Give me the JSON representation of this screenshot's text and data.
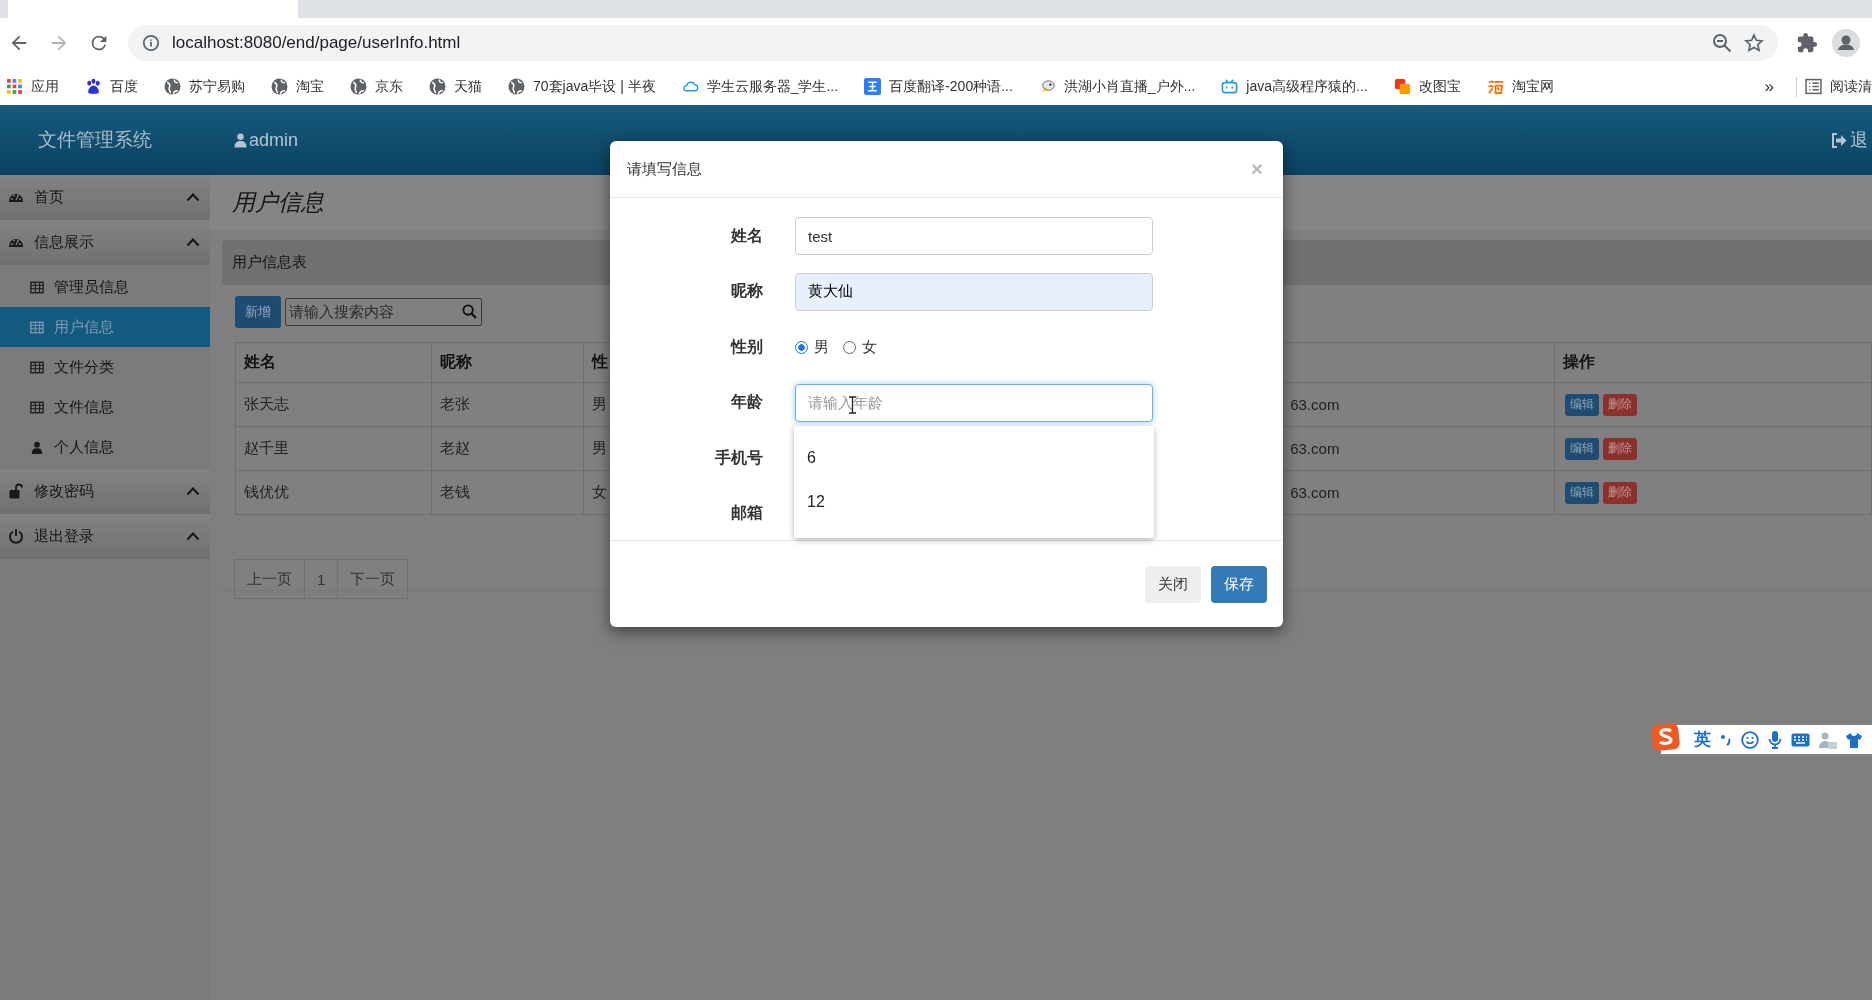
{
  "browser": {
    "url": "localhost:8080/end/page/userInfo.html",
    "bookmarks": [
      {
        "label": "应用",
        "kind": "apps"
      },
      {
        "label": "百度",
        "kind": "paw"
      },
      {
        "label": "苏宁易购",
        "kind": "globe"
      },
      {
        "label": "淘宝",
        "kind": "globe"
      },
      {
        "label": "京东",
        "kind": "globe"
      },
      {
        "label": "天猫",
        "kind": "globe"
      },
      {
        "label": "70套java毕设 | 半夜",
        "kind": "globe"
      },
      {
        "label": "学生云服务器_学生...",
        "kind": "cloud"
      },
      {
        "label": "百度翻译-200种语...",
        "kind": "translate"
      },
      {
        "label": "洪湖小肖直播_户外...",
        "kind": "bird"
      },
      {
        "label": "java高级程序猿的...",
        "kind": "tv"
      },
      {
        "label": "改图宝",
        "kind": "squares"
      },
      {
        "label": "淘宝网",
        "kind": "tao"
      }
    ],
    "overflow": "»",
    "reading_list": "阅读清"
  },
  "app": {
    "title": "文件管理系统",
    "user": "admin",
    "logout": "退"
  },
  "sidebar": {
    "groups": [
      {
        "label": "首页",
        "kind": "dashboard"
      },
      {
        "label": "信息展示",
        "kind": "dashboard",
        "items": [
          {
            "label": "管理员信息",
            "kind": "table",
            "selected": false
          },
          {
            "label": "用户信息",
            "kind": "table",
            "selected": true
          },
          {
            "label": "文件分类",
            "kind": "table",
            "selected": false
          },
          {
            "label": "文件信息",
            "kind": "table",
            "selected": false
          },
          {
            "label": "个人信息",
            "kind": "user",
            "selected": false
          }
        ]
      },
      {
        "label": "修改密码",
        "kind": "lock"
      },
      {
        "label": "退出登录",
        "kind": "power"
      }
    ]
  },
  "page": {
    "title": "用户信息",
    "panel_title": "用户信息表",
    "add_button": "新增",
    "search": {
      "placeholder": "请输入搜索内容"
    },
    "table": {
      "columns": [
        "姓名",
        "昵称",
        "性",
        "操作"
      ],
      "rows": [
        {
          "cells": [
            "张天志",
            "老张",
            "男",
            "63.com"
          ],
          "actions": [
            "编辑",
            "删除"
          ]
        },
        {
          "cells": [
            "赵千里",
            "老赵",
            "男",
            "63.com"
          ],
          "actions": [
            "编辑",
            "删除"
          ]
        },
        {
          "cells": [
            "钱优优",
            "老钱",
            "女",
            "63.com"
          ],
          "actions": [
            "编辑",
            "删除"
          ]
        }
      ]
    },
    "pagination": [
      "上一页",
      "1",
      "下一页"
    ]
  },
  "modal": {
    "title": "请填写信息",
    "close": "×",
    "fields": [
      {
        "label": "姓名",
        "kind": "text",
        "value": "test",
        "autofilled": false,
        "focused": false
      },
      {
        "label": "昵称",
        "kind": "text",
        "value": "黄大仙",
        "autofilled": true,
        "focused": false
      },
      {
        "label": "性别",
        "kind": "radio",
        "options": [
          {
            "label": "男",
            "selected": true
          },
          {
            "label": "女",
            "selected": false
          }
        ]
      },
      {
        "label": "年龄",
        "kind": "text",
        "placeholder": "请输入年龄",
        "autofilled": false,
        "focused": true,
        "suggestions": [
          "6",
          "12"
        ]
      },
      {
        "label": "手机号",
        "kind": "covered"
      },
      {
        "label": "邮箱",
        "kind": "covered"
      }
    ],
    "buttons": [
      {
        "label": "关闭",
        "kind": "default"
      },
      {
        "label": "保存",
        "kind": "primary"
      }
    ]
  },
  "ime": {
    "mode": "英"
  }
}
